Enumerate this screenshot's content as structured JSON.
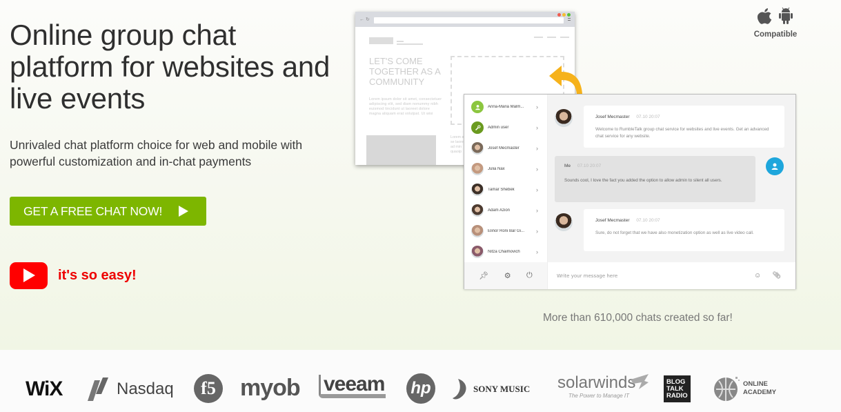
{
  "hero": {
    "headline": "Online group chat platform for websites and live events",
    "subhead": "Unrivaled chat platform choice for web and mobile with powerful customization and in-chat payments",
    "cta_label": "GET A FREE CHAT NOW!",
    "video_link_label": "it's so easy!",
    "chats_count_text": "More than 610,000 chats created so far!"
  },
  "compatibility": {
    "label": "Compatible",
    "icons": [
      "apple-icon",
      "android-icon"
    ]
  },
  "browser_mock": {
    "headline": "LET'S COME TOGETHER AS A COMMUNITY",
    "lorem": "Lorem ipsum dolor sit amet, consectetuer adipiscing elit, sed diam nonummy nibh euismod tincidunt ut laoreet dolore magna aliquam erat volutpat. Ut wisi",
    "lorem2": "Lorem elit, se laoreet ad min quaoip"
  },
  "chat_widget": {
    "users": [
      {
        "name": "Anna-Maria Malm...",
        "avatar": "user-icon",
        "color": "#8cc63f"
      },
      {
        "name": "Admin user",
        "avatar": "wrench-icon",
        "color": "#6a9a1f"
      },
      {
        "name": "Josef Mecmaster",
        "avatar": "photo",
        "color": "#7b6a5a"
      },
      {
        "name": "Julia Nax",
        "avatar": "photo",
        "color": "#c49a80"
      },
      {
        "name": "Tamar Shebek",
        "avatar": "photo",
        "color": "#3d3028"
      },
      {
        "name": "Adam Azion",
        "avatar": "photo",
        "color": "#4d3b30"
      },
      {
        "name": "Elinor Roni Bar Gi...",
        "avatar": "photo",
        "color": "#b8907a"
      },
      {
        "name": "Nitza Chaimovich",
        "avatar": "photo",
        "color": "#8a5a6a"
      }
    ],
    "footer_icons": [
      "pin-icon",
      "gear-icon",
      "power-icon"
    ],
    "messages": [
      {
        "author": "Josef Mecmaster",
        "time": "07.10 20:07",
        "text": "Welcome to RumbleTalk group chat service for websites and live events. Get an advanced chat service for any website.",
        "mine": false
      },
      {
        "author": "Me",
        "time": "07.10 20:07",
        "text": "Sounds cool, I love the fact you added the option to allow admin to silent all users.",
        "mine": true
      },
      {
        "author": "Josef Mecmaster",
        "time": "07.10 20:07",
        "text": "Sure, do not forget that we have also monetization option as well as live video call.",
        "mine": false
      }
    ],
    "compose_placeholder": "Write your message here",
    "compose_icons": [
      "emoji-icon",
      "attachment-icon"
    ]
  },
  "client_logos": [
    "WiX",
    "Nasdaq",
    "f5",
    "myob",
    "veeam",
    "hp",
    "SONY MUSIC",
    "solarwinds",
    "BLOG TALK RADIO",
    "ONLINE ACADEMY"
  ],
  "client_logo_extras": {
    "solarwinds_tagline": "The Power to Manage IT"
  },
  "colors": {
    "cta": "#7db600",
    "youtube": "#ff0000",
    "easy_text": "#ee0000",
    "arrow": "#f6b21b",
    "me_avatar": "#1ea6dc"
  }
}
